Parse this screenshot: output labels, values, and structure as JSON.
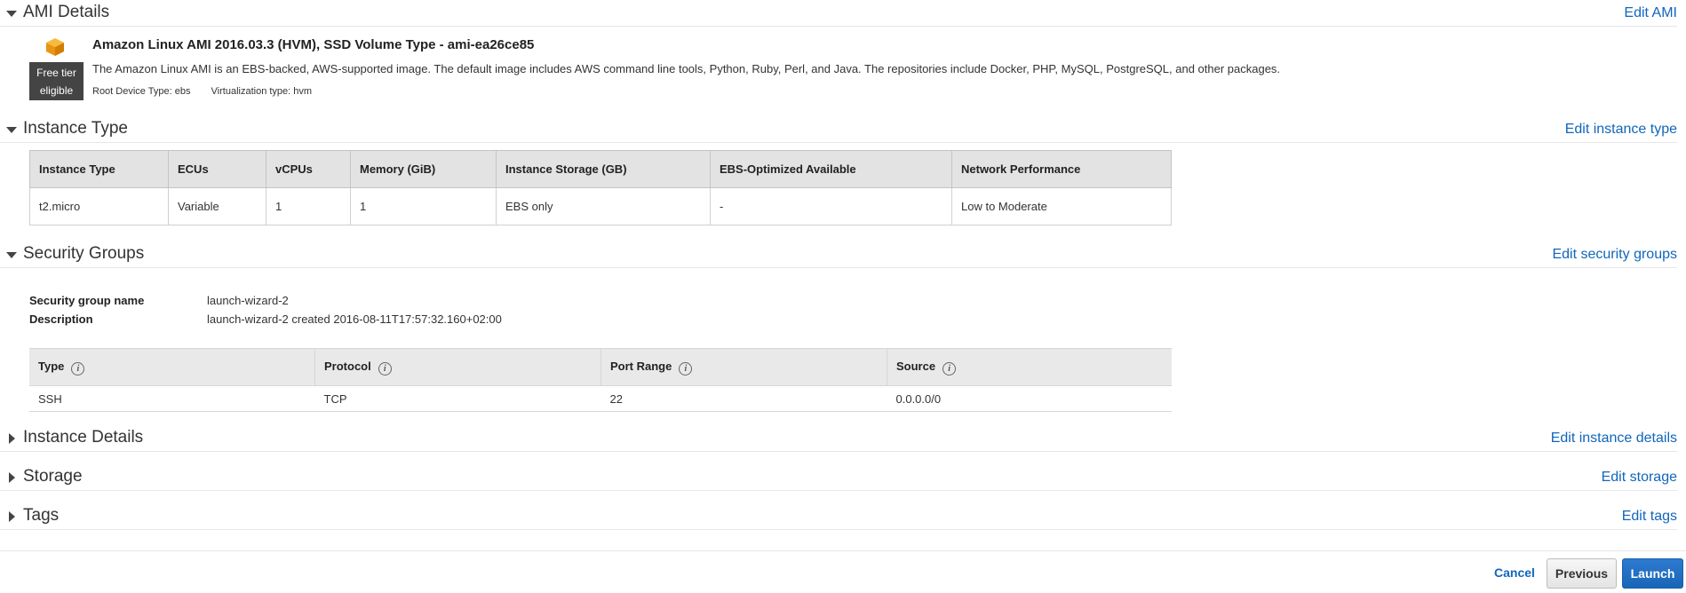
{
  "sections": {
    "ami": {
      "title": "AMI Details",
      "edit": "Edit AMI"
    },
    "instance_type": {
      "title": "Instance Type",
      "edit": "Edit instance type"
    },
    "security_groups": {
      "title": "Security Groups",
      "edit": "Edit security groups"
    },
    "instance_details": {
      "title": "Instance Details",
      "edit": "Edit instance details"
    },
    "storage": {
      "title": "Storage",
      "edit": "Edit storage"
    },
    "tags": {
      "title": "Tags",
      "edit": "Edit tags"
    }
  },
  "ami": {
    "badge_line1": "Free tier",
    "badge_line2": "eligible",
    "name": "Amazon Linux AMI 2016.03.3 (HVM), SSD Volume Type - ami-ea26ce85",
    "description": "The Amazon Linux AMI is an EBS-backed, AWS-supported image. The default image includes AWS command line tools, Python, Ruby, Perl, and Java. The repositories include Docker, PHP, MySQL, PostgreSQL, and other packages.",
    "root_device": "Root Device Type: ebs",
    "virtualization": "Virtualization type: hvm",
    "icon_color": "#f0a30a"
  },
  "instance_table": {
    "headers": [
      "Instance Type",
      "ECUs",
      "vCPUs",
      "Memory (GiB)",
      "Instance Storage (GB)",
      "EBS-Optimized Available",
      "Network Performance"
    ],
    "row": [
      "t2.micro",
      "Variable",
      "1",
      "1",
      "EBS only",
      "-",
      "Low to Moderate"
    ]
  },
  "security_group": {
    "name_label": "Security group name",
    "name_value": "launch-wizard-2",
    "desc_label": "Description",
    "desc_value": "launch-wizard-2 created 2016-08-11T17:57:32.160+02:00",
    "headers": [
      "Type",
      "Protocol",
      "Port Range",
      "Source"
    ],
    "info_glyph": "i",
    "row": [
      "SSH",
      "TCP",
      "22",
      "0.0.0.0/0"
    ]
  },
  "footer": {
    "cancel": "Cancel",
    "previous": "Previous",
    "launch": "Launch"
  }
}
